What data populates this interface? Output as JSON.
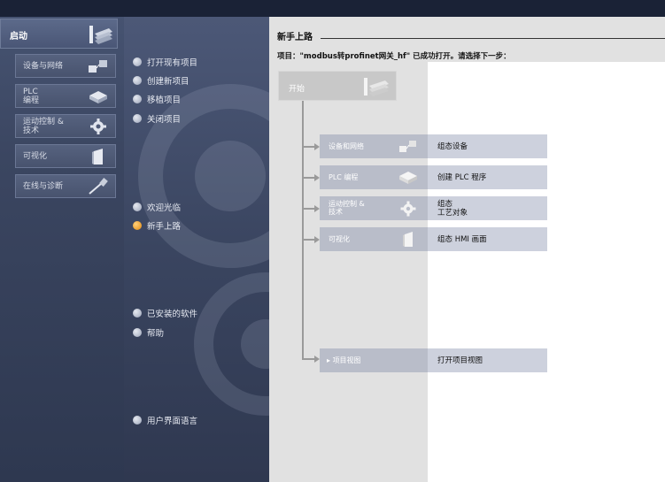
{
  "nav": {
    "start_label": "启动",
    "items": [
      {
        "label": "设备与网络"
      },
      {
        "label": "PLC\n编程"
      },
      {
        "label": "运动控制 &\n技术"
      },
      {
        "label": "可视化"
      },
      {
        "label": "在线与诊断"
      }
    ]
  },
  "options": [
    {
      "label": "打开现有项目"
    },
    {
      "label": "创建新项目"
    },
    {
      "label": "移植项目"
    },
    {
      "label": "关闭项目"
    },
    {
      "label": "欢迎光临"
    },
    {
      "label": "新手上路"
    },
    {
      "label": "已安装的软件"
    },
    {
      "label": "帮助"
    },
    {
      "label": "用户界面语言"
    }
  ],
  "content": {
    "title": "新手上路",
    "subtitle": "项目：\"modbus转profinet网关_hf\" 已成功打开。请选择下一步：",
    "start_box": "开始",
    "steps": [
      {
        "label": "设备和网络",
        "action": "组态设备"
      },
      {
        "label": "PLC 编程",
        "action": "创建 PLC 程序"
      },
      {
        "label": "运动控制 &\n技术",
        "action": "组态\n工艺对象"
      },
      {
        "label": "可视化",
        "action": "组态 HMI 画面"
      },
      {
        "label": "项目视图",
        "action": "打开项目视图"
      }
    ]
  },
  "colors": {
    "active_dot": "#e28a10",
    "nav_bg": "#3b4661"
  }
}
